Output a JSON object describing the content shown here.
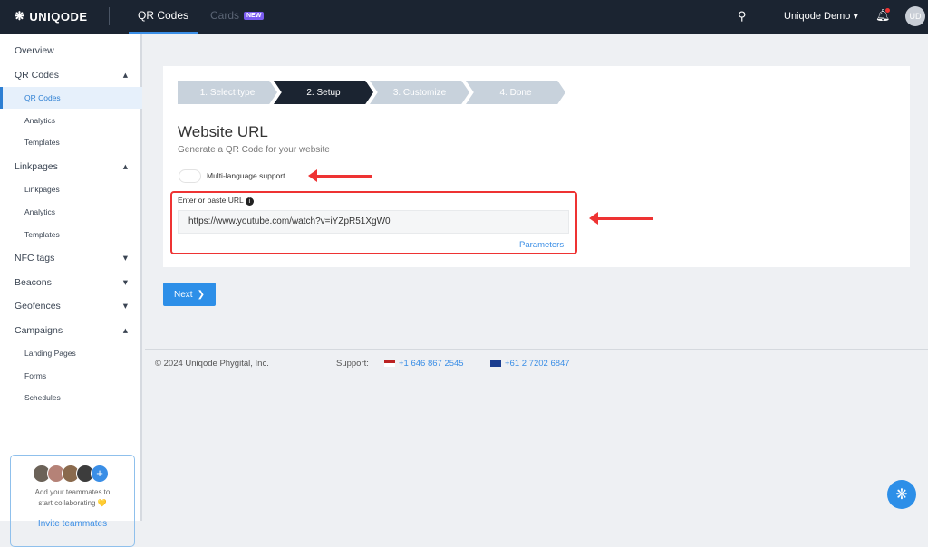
{
  "topbar": {
    "brand": "UNIQODE",
    "tabs": [
      {
        "label": "QR Codes"
      },
      {
        "label": "Cards"
      }
    ],
    "new_badge": "NEW",
    "user": "Uniqode Demo",
    "avatar": "UD"
  },
  "sidebar": {
    "items": [
      {
        "label": "Overview",
        "chev": ""
      },
      {
        "label": "QR Codes",
        "chev": "▴"
      },
      {
        "label": "QR Codes",
        "sub": true
      },
      {
        "label": "Analytics",
        "sub": true
      },
      {
        "label": "Templates",
        "sub": true
      },
      {
        "label": "Linkpages",
        "chev": "▴"
      },
      {
        "label": "Linkpages",
        "sub": true
      },
      {
        "label": "Analytics",
        "sub": true
      },
      {
        "label": "Templates",
        "sub": true
      },
      {
        "label": "NFC tags",
        "chev": "▾"
      },
      {
        "label": "Beacons",
        "chev": "▾"
      },
      {
        "label": "Geofences",
        "chev": "▾"
      },
      {
        "label": "Campaigns",
        "chev": "▴"
      },
      {
        "label": "Landing Pages",
        "sub": true
      },
      {
        "label": "Forms",
        "sub": true
      },
      {
        "label": "Schedules",
        "sub": true
      }
    ],
    "invite": {
      "text1": "Add your teammates to",
      "text2": "start collaborating 💛",
      "link": "Invite teammates"
    }
  },
  "steps": [
    "1. Select type",
    "2. Setup",
    "3. Customize",
    "4. Done"
  ],
  "form": {
    "title": "Website URL",
    "subtitle": "Generate a QR Code for your website",
    "toggle_label": "Multi-language support",
    "toggle_on": false,
    "url_label": "Enter or paste URL",
    "url_value": "https://www.youtube.com/watch?v=iYZpR51XgW0",
    "parameters": "Parameters",
    "next": "Next"
  },
  "footer": {
    "copyright": "© 2024 Uniqode Phygital, Inc.",
    "support": "Support:",
    "phone_us": "+1 646 867 2545",
    "phone_au": "+61 2 7202 6847"
  },
  "colors": {
    "accent": "#2d8fe8",
    "nav": "#1b2431",
    "annotation": "#e33333"
  }
}
